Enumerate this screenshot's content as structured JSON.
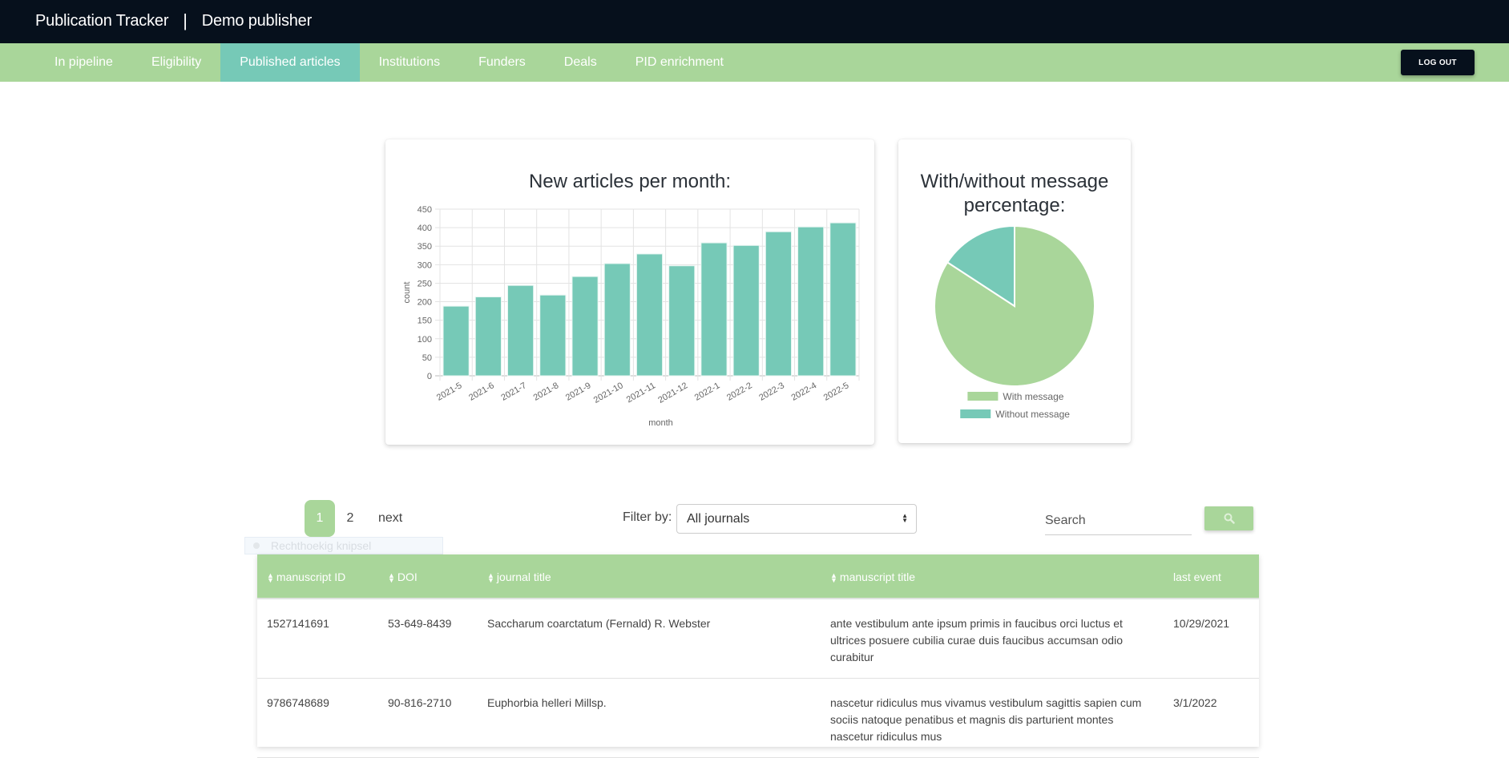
{
  "header": {
    "app_title": "Publication Tracker",
    "separator": "|",
    "publisher": "Demo publisher"
  },
  "nav": {
    "items": [
      {
        "label": "In pipeline",
        "active": false
      },
      {
        "label": "Eligibility",
        "active": false
      },
      {
        "label": "Published articles",
        "active": true
      },
      {
        "label": "Institutions",
        "active": false
      },
      {
        "label": "Funders",
        "active": false
      },
      {
        "label": "Deals",
        "active": false
      },
      {
        "label": "PID enrichment",
        "active": false
      }
    ],
    "logout_label": "LOG OUT"
  },
  "colors": {
    "topbar": "#06101c",
    "nav_green": "#a9d69a",
    "teal": "#76c9b7"
  },
  "chart_data": [
    {
      "type": "bar",
      "title": "New articles per month:",
      "xlabel": "month",
      "ylabel": "count",
      "categories": [
        "2021-5",
        "2021-6",
        "2021-7",
        "2021-8",
        "2021-9",
        "2021-10",
        "2021-11",
        "2021-12",
        "2022-1",
        "2022-2",
        "2022-3",
        "2022-4",
        "2022-5"
      ],
      "values": [
        188,
        213,
        244,
        218,
        268,
        303,
        329,
        297,
        359,
        352,
        389,
        402,
        413
      ],
      "ylim": [
        0,
        450
      ],
      "yticks": [
        0,
        50,
        100,
        150,
        200,
        250,
        300,
        350,
        400,
        450
      ],
      "grid": true,
      "color": "#76c9b7"
    },
    {
      "type": "pie",
      "title": "With/without message percentage:",
      "labels": [
        "With message",
        "Without message"
      ],
      "values": [
        84.2,
        15.8
      ],
      "colors": [
        "#a9d69a",
        "#76c9b7"
      ],
      "legend": "bottom"
    }
  ],
  "pagination": {
    "pages": [
      "1",
      "2"
    ],
    "current": "1",
    "next_label": "next"
  },
  "overlay": {
    "label": "Rechthoekig knipsel"
  },
  "filter": {
    "label": "Filter by:",
    "selected": "All journals"
  },
  "search": {
    "placeholder": "Search",
    "value": ""
  },
  "table": {
    "columns": [
      {
        "label": "manuscript ID",
        "sortable": true
      },
      {
        "label": "DOI",
        "sortable": true
      },
      {
        "label": "journal title",
        "sortable": true
      },
      {
        "label": "manuscript title",
        "sortable": true
      },
      {
        "label": "last event",
        "sortable": false
      }
    ],
    "rows": [
      {
        "manuscript_id": "1527141691",
        "doi": "53-649-8439",
        "journal_title": "Saccharum coarctatum (Fernald) R. Webster",
        "manuscript_title": "ante vestibulum ante ipsum primis in faucibus orci luctus et ultrices posuere cubilia curae duis faucibus accumsan odio curabitur",
        "last_event": "10/29/2021"
      },
      {
        "manuscript_id": "9786748689",
        "doi": "90-816-2710",
        "journal_title": "Euphorbia helleri Millsp.",
        "manuscript_title": "nascetur ridiculus mus vivamus vestibulum sagittis sapien cum sociis natoque penatibus et magnis dis parturient montes nascetur ridiculus mus",
        "last_event": "3/1/2022"
      }
    ]
  }
}
